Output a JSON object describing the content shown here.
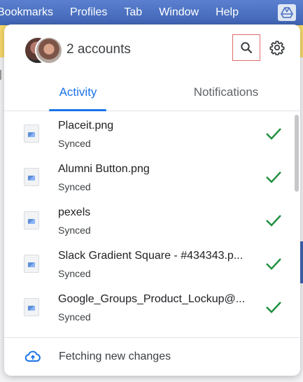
{
  "menubar": {
    "items": [
      "Bookmarks",
      "Profiles",
      "Tab",
      "Window",
      "Help"
    ],
    "tray_icon": "google-drive-icon"
  },
  "header": {
    "accounts_label": "2 accounts",
    "search_icon": "search-icon",
    "settings_icon": "gear-icon"
  },
  "tabs": {
    "activity": "Activity",
    "notifications": "Notifications",
    "selected": "Activity"
  },
  "files": [
    {
      "name": "Placeit.png",
      "status": "Synced"
    },
    {
      "name": "Alumni Button.png",
      "status": "Synced"
    },
    {
      "name": "pexels",
      "status": "Synced"
    },
    {
      "name": "Slack Gradient Square - #434343.p...",
      "status": "Synced"
    },
    {
      "name": "Google_Groups_Product_Lockup@...",
      "status": "Synced"
    }
  ],
  "footer": {
    "status_text": "Fetching new changes",
    "icon": "cloud-sync-icon"
  },
  "colors": {
    "accent": "#1a73e8",
    "check": "#1e8e3e",
    "menubar": "#4a6fbf"
  }
}
